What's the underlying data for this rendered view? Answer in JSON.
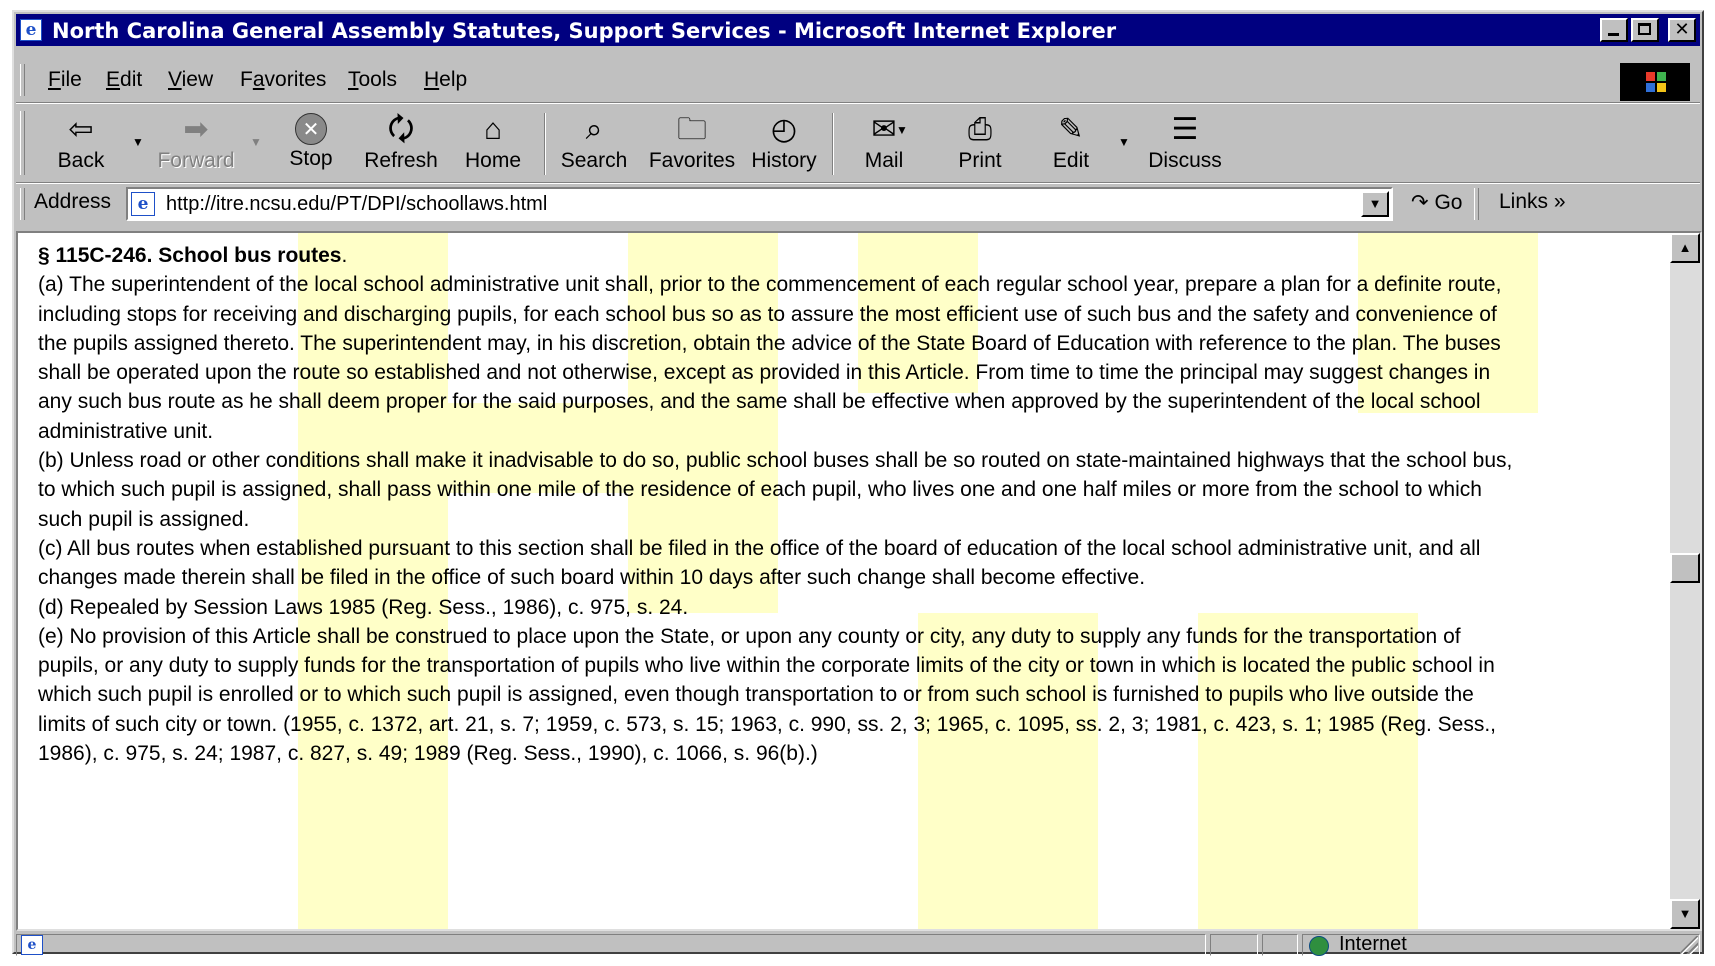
{
  "window": {
    "title": "North Carolina General Assembly Statutes, Support Services - Microsoft Internet Explorer",
    "icon": "ie-page-icon"
  },
  "menu": {
    "items": [
      {
        "label": "File",
        "accel": "F",
        "rest": "ile"
      },
      {
        "label": "Edit",
        "accel": "E",
        "rest": "dit"
      },
      {
        "label": "View",
        "accel": "V",
        "rest": "iew"
      },
      {
        "label": "Favorites",
        "accel": "a",
        "pre": "F",
        "rest": "vorites"
      },
      {
        "label": "Tools",
        "accel": "T",
        "rest": "ools"
      },
      {
        "label": "Help",
        "accel": "H",
        "rest": "elp"
      }
    ]
  },
  "toolbar": {
    "back": "Back",
    "forward": "Forward",
    "stop": "Stop",
    "refresh": "Refresh",
    "home": "Home",
    "search": "Search",
    "favorites": "Favorites",
    "history": "History",
    "mail": "Mail",
    "print": "Print",
    "edit": "Edit",
    "discuss": "Discuss"
  },
  "address": {
    "label": "Address",
    "url": "http://itre.ncsu.edu/PT/DPI/schoollaws.html",
    "go": "Go",
    "links": "Links"
  },
  "document": {
    "section_symbol": "§ 115C-246.",
    "section_title": "School bus routes",
    "para_a": "(a) The superintendent of the local school administrative unit shall, prior to the commencement of each regular school year, prepare a plan for a definite route, including stops for receiving and discharging pupils, for each school bus so as to assure the most efficient use of such bus and the safety and convenience of the pupils assigned thereto. The superintendent may, in his discretion, obtain the advice of the State Board of Education with reference to the plan. The buses shall be operated upon the route so established and not otherwise, except as provided in this Article. From time to time the principal may suggest changes in any such bus route as he shall deem proper for the said purposes, and the same shall be effective when approved by the superintendent of the local school administrative unit.",
    "para_b": "(b) Unless road or other conditions shall make it inadvisable to do so, public school buses shall be so routed on state-maintained highways that the school bus, to which such pupil is assigned, shall pass within one mile of the residence of each pupil, who lives one and one half miles or more from the school to which such pupil is assigned.",
    "para_c": "(c) All bus routes when established pursuant to this section shall be filed in the office of the board of education of the local school administrative unit, and all changes made therein shall be filed in the office of such board within 10 days after such change shall become effective.",
    "para_d": "(d) Repealed by Session Laws 1985 (Reg. Sess., 1986), c. 975, s. 24.",
    "para_e": "(e) No provision of this Article shall be construed to place upon the State, or upon any county or city, any duty to supply any funds for the transportation of pupils, or any duty to supply funds for the transportation of pupils who live within the corporate limits of the city or town in which is located the public school in which such pupil is enrolled or to which such pupil is assigned, even though transportation to or from such school is furnished to pupils who live outside the limits of such city or town. (1955, c. 1372, art. 21, s. 7; 1959, c. 573, s. 15; 1963, c. 990, ss. 2, 3; 1965, c. 1095, ss. 2, 3; 1981, c. 423, s. 1; 1985 (Reg. Sess., 1986), c. 975, s. 24; 1987, c. 827, s. 49; 1989 (Reg. Sess., 1990), c. 1066, s. 96(b).)"
  },
  "status": {
    "zone": "Internet"
  },
  "colors": {
    "titlebar": "#000080",
    "chrome": "#c0c0c0",
    "watermark": "#ffffc8"
  }
}
